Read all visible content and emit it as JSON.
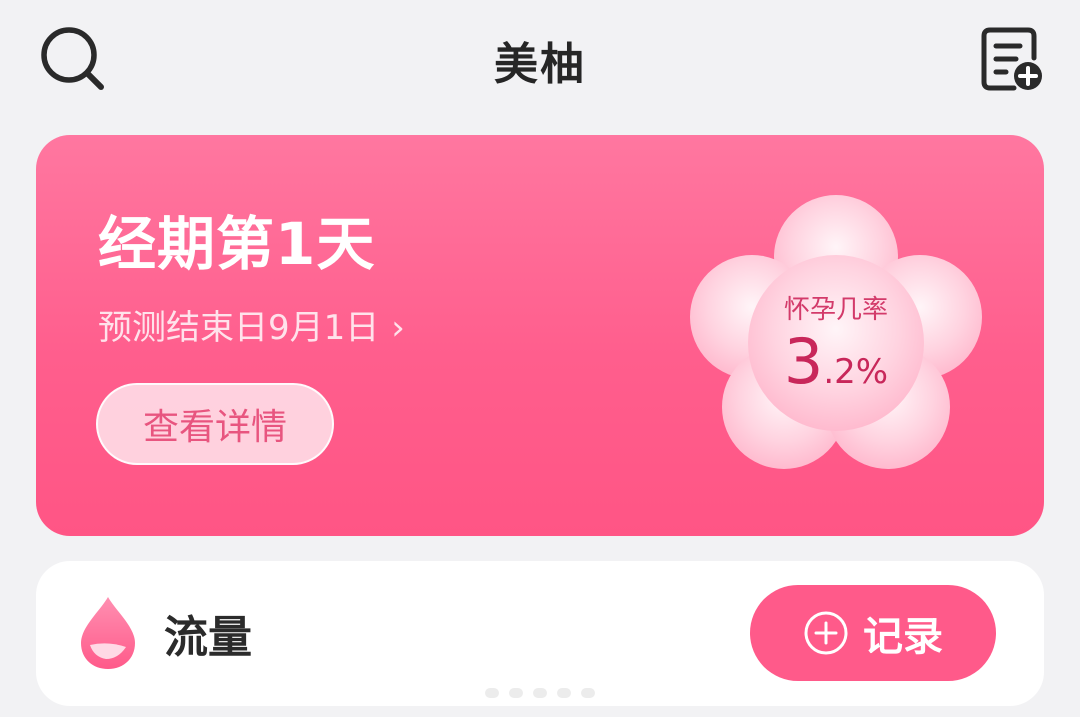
{
  "header": {
    "title": "美柚",
    "search_icon": "search-icon",
    "note_icon": "note-add-icon"
  },
  "period_card": {
    "day_title": "经期第1天",
    "predict_text": "预测结束日9月1日",
    "chevron": "›",
    "details_button": "查看详情",
    "pregnancy_label": "怀孕几率",
    "pregnancy_value_int": "3",
    "pregnancy_value_dec": ".2%",
    "colors": {
      "card_top": "#ff77a0",
      "card_bottom": "#ff5585",
      "accent_text": "#c8275a"
    }
  },
  "flow_card": {
    "label": "流量",
    "record_button": "记录",
    "drop_icon": "drop-icon",
    "colors": {
      "button": "#ff5a8a"
    }
  }
}
